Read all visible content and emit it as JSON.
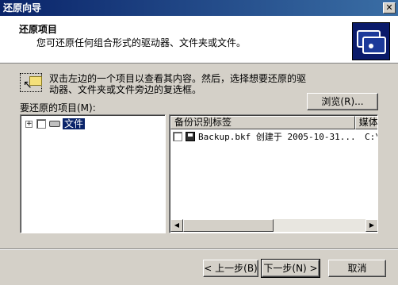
{
  "window": {
    "title": "还原向导",
    "close_glyph": "✕"
  },
  "header": {
    "title": "还原项目",
    "subtitle": "您可还原任何组合形式的驱动器、文件夹或文件。",
    "icon": "backup-cards-icon"
  },
  "instructions": {
    "line1": "双击左边的一个项目以查看其内容。然后，选择想要还原的驱",
    "line2": "动器、文件夹或文件旁边的复选框。",
    "icon": "cursor-folder-icon"
  },
  "browse_button": "浏览(R)...",
  "items_label": "要还原的项目(M):",
  "tree": {
    "items": [
      {
        "expander": "+",
        "label": "文件",
        "checked": false,
        "selected": true,
        "icon": "drive-icon"
      }
    ]
  },
  "listview": {
    "columns": [
      "备份识别标签",
      "媒体"
    ],
    "rows": [
      {
        "checked": false,
        "icon": "backup-file-icon",
        "label": "Backup.bkf 创建于 2005-10-31...",
        "media": "C:\\"
      }
    ]
  },
  "scrollbar": {
    "left_glyph": "◀",
    "right_glyph": "▶"
  },
  "footer": {
    "back_label": "< 上一步(B)",
    "next_label": "下一步(N) >",
    "cancel_label": "取消"
  }
}
